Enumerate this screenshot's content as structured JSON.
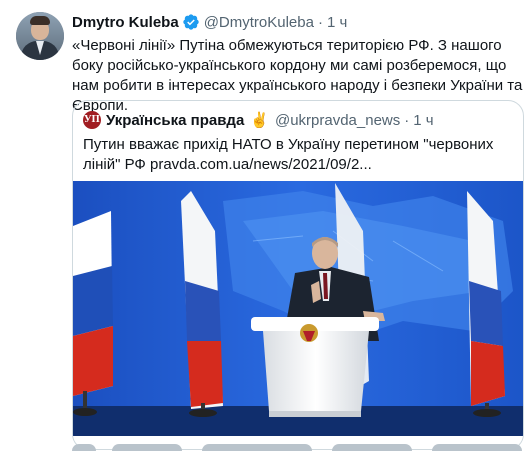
{
  "tweet": {
    "display_name": "Dmytro Kuleba",
    "handle": "@DmytroKuleba",
    "separator": "·",
    "time": "1 ч",
    "text": "«Червоні лінії» Путіна обмежуються територією РФ. З нашого боку російсько-українського кордону ми самі розберемося, що нам робити в інтересах українського народу і безпеки України та Європи.",
    "avatar_icon": "profile-photo",
    "verified_icon": "verified-badge-icon",
    "colors": {
      "verified": "#1d9bf0",
      "secondary_text": "#536471",
      "border": "#cfd9de"
    }
  },
  "quote": {
    "logo_text": "УП",
    "display_name": "Українська правда",
    "emoji": "✌️",
    "handle": "@ukrpravda_news",
    "separator": "·",
    "time": "1 ч",
    "text": "Путин вважає прихід НАТО в Україну перетином \"червоних ліній\" РФ pravda.com.ua/news/2021/09/2...",
    "image_icon": "news-photo",
    "colors": {
      "logo_bg": "#a11d22"
    }
  }
}
